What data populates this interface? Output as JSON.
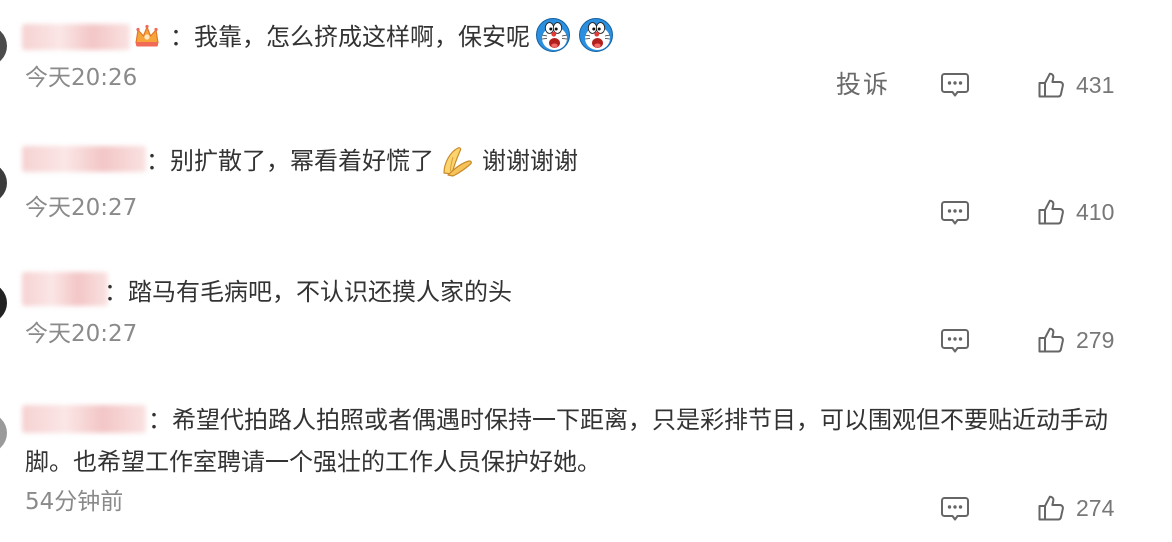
{
  "theme": {
    "background": "#ffffff",
    "text_color": "#333333",
    "meta_color": "#8a8a8a",
    "icon_color": "#666666",
    "count_color": "#777777"
  },
  "icons": {
    "reply": "comment-icon",
    "like": "thumbs-up-icon",
    "badge": "crown-badge-icon"
  },
  "comments": [
    {
      "text": "：我靠，怎么挤成这样啊，保安呢",
      "emojis": [
        "doraemon-shocked-emoji",
        "doraemon-shocked-emoji"
      ],
      "time": "今天20:26",
      "report_label": "投诉",
      "likes": 431
    },
    {
      "text": "：别扩散了，幂看着好慌了",
      "emoji": "pray-hands-emoji",
      "text_after_emoji": "谢谢谢谢",
      "time": "今天20:27",
      "likes": 410
    },
    {
      "text": "：踏马有毛病吧，不认识还摸人家的头",
      "time": "今天20:27",
      "likes": 279
    },
    {
      "text": "：希望代拍路人拍照或者偶遇时保持一下距离，只是彩排节目，可以围观但不要贴近动手动脚。也希望工作室聘请一个强壮的工作人员保护好她。",
      "time": "54分钟前",
      "likes": 274
    }
  ]
}
